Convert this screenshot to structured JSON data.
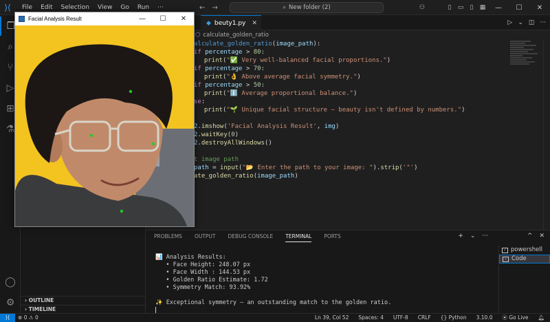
{
  "menu": [
    "File",
    "Edit",
    "Selection",
    "View",
    "Go",
    "Run",
    "···"
  ],
  "search": {
    "label": "New folder (2)"
  },
  "sidebar": {
    "outline": "OUTLINE",
    "timeline": "TIMELINE"
  },
  "editor": {
    "tab_label": "beuty1.py",
    "breadcrumb": "calculate_golden_ratio"
  },
  "code_lines": [
    [
      [
        "kwb",
        "alculate_golden_ratio"
      ],
      [
        "plain",
        "("
      ],
      [
        "var",
        "image_path"
      ],
      [
        "plain",
        "):"
      ]
    ],
    [
      [
        "kw",
        "if "
      ],
      [
        "var",
        "percentage"
      ],
      [
        "plain",
        " > "
      ],
      [
        "num",
        "80"
      ],
      [
        "plain",
        ":"
      ]
    ],
    [
      [
        "plain",
        "  "
      ],
      [
        "fn",
        "print"
      ],
      [
        "plain",
        "("
      ],
      [
        "str",
        "\"✅ Very well-balanced facial proportions.\""
      ],
      [
        "plain",
        ")"
      ]
    ],
    [
      [
        "kw",
        "if "
      ],
      [
        "var",
        "percentage"
      ],
      [
        "plain",
        " > "
      ],
      [
        "num",
        "70"
      ],
      [
        "plain",
        ":"
      ]
    ],
    [
      [
        "plain",
        "  "
      ],
      [
        "fn",
        "print"
      ],
      [
        "plain",
        "("
      ],
      [
        "str",
        "\"👌 Above average facial symmetry.\""
      ],
      [
        "plain",
        ")"
      ]
    ],
    [
      [
        "kw",
        "if "
      ],
      [
        "var",
        "percentage"
      ],
      [
        "plain",
        " > "
      ],
      [
        "num",
        "50"
      ],
      [
        "plain",
        ":"
      ]
    ],
    [
      [
        "plain",
        "  "
      ],
      [
        "fn",
        "print"
      ],
      [
        "plain",
        "("
      ],
      [
        "str",
        "\"ℹ️ Average proportional balance.\""
      ],
      [
        "plain",
        ")"
      ]
    ],
    [
      [
        "kw",
        "se"
      ],
      [
        "plain",
        ":"
      ]
    ],
    [
      [
        "plain",
        "  "
      ],
      [
        "fn",
        "print"
      ],
      [
        "plain",
        "("
      ],
      [
        "str",
        "\"🌱 Unique facial structure — beauty isn't defined by numbers.\""
      ],
      [
        "plain",
        ")"
      ]
    ],
    [
      [
        "plain",
        ""
      ]
    ],
    [
      [
        "var",
        "2"
      ],
      [
        "plain",
        "."
      ],
      [
        "fn",
        "imshow"
      ],
      [
        "plain",
        "("
      ],
      [
        "str",
        "'Facial Analysis Result'"
      ],
      [
        "plain",
        ", "
      ],
      [
        "var",
        "img"
      ],
      [
        "plain",
        ")"
      ]
    ],
    [
      [
        "var",
        "2"
      ],
      [
        "plain",
        "."
      ],
      [
        "fn",
        "waitKey"
      ],
      [
        "plain",
        "("
      ],
      [
        "num",
        "0"
      ],
      [
        "plain",
        ")"
      ]
    ],
    [
      [
        "var",
        "2"
      ],
      [
        "plain",
        "."
      ],
      [
        "fn",
        "destroyAllWindows"
      ],
      [
        "plain",
        "()"
      ]
    ],
    [
      [
        "plain",
        ""
      ]
    ],
    [
      [
        "cm",
        "t image path"
      ]
    ],
    [
      [
        "var",
        "path"
      ],
      [
        "plain",
        " = "
      ],
      [
        "fn",
        "input"
      ],
      [
        "plain",
        "("
      ],
      [
        "str",
        "\"📂 Enter the path to your image: \""
      ],
      [
        "plain",
        ")."
      ],
      [
        "fn",
        "strip"
      ],
      [
        "plain",
        "("
      ],
      [
        "str",
        "'\"'"
      ],
      [
        "plain",
        ")"
      ]
    ],
    [
      [
        "fn",
        "ate_golden_ratio"
      ],
      [
        "plain",
        "("
      ],
      [
        "var",
        "image_path"
      ],
      [
        "plain",
        ")"
      ]
    ]
  ],
  "panel": {
    "tabs": [
      "PROBLEMS",
      "OUTPUT",
      "DEBUG CONSOLE",
      "TERMINAL",
      "PORTS"
    ],
    "active_tab": "TERMINAL",
    "terminal_lines": [
      "📊 Analysis Results:",
      "   • Face Height: 248.07 px",
      "   • Face Width : 144.53 px",
      "   • Golden Ratio Estimate: 1.72",
      "   • Symmetry Match: 93.92%",
      "",
      "✨ Exceptional symmetry — an outstanding match to the golden ratio."
    ],
    "terminals": [
      "powershell",
      "Code"
    ]
  },
  "status": {
    "errors": "0",
    "warnings": "0",
    "position": "Ln 39, Col 52",
    "spaces": "Spaces: 4",
    "encoding": "UTF-8",
    "eol": "CRLF",
    "language": "{} Python",
    "version": "3.10.0",
    "golive": "Go Live"
  },
  "cv_window": {
    "title": "Facial Analysis Result"
  },
  "colors": {
    "accent": "#0078d4",
    "landmark": "#22cc22",
    "photo_bg": "#f3c320"
  }
}
